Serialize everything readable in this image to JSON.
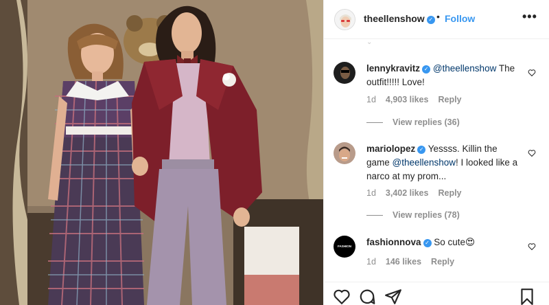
{
  "post": {
    "username": "theellenshow",
    "separator": "•",
    "follow_label": "Follow",
    "more_label": "•••"
  },
  "comments": [
    {
      "username": "lennykravitz",
      "verified": true,
      "mention": "@theellenshow",
      "text_after": " The outfit!!!!! Love!",
      "time": "1d",
      "likes": "4,903 likes",
      "reply_label": "Reply",
      "view_replies": "View replies (36)"
    },
    {
      "username": "mariolopez",
      "verified": true,
      "text_before": " Yessss. Killin the game ",
      "mention": "@theellenshow",
      "text_after": "! I looked like a narco at my prom...",
      "time": "1d",
      "likes": "3,402 likes",
      "reply_label": "Reply",
      "view_replies": "View replies (78)"
    },
    {
      "username": "fashionnova",
      "verified": true,
      "text": " So cute😍",
      "time": "1d",
      "likes": "146 likes",
      "reply_label": "Reply",
      "avatar_text": "FASHION NOVA"
    }
  ],
  "icons": {
    "avatar": "ellen-avatar-icon",
    "verified": "verified-badge-icon",
    "like": "heart-icon",
    "comment": "comment-icon",
    "share": "share-icon",
    "save": "bookmark-icon"
  },
  "colors": {
    "accent": "#3897f0",
    "text": "#262626",
    "muted": "#8e8e8e",
    "mention": "#00376b"
  }
}
